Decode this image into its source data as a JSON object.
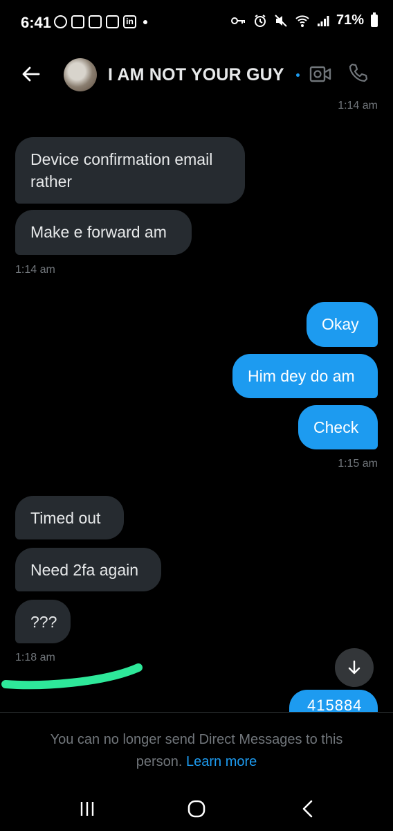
{
  "status_bar": {
    "time": "6:41",
    "battery": "71%",
    "notification_icons": [
      "facebook-icon",
      "app-icon",
      "app-icon",
      "app-icon",
      "linkedin-icon"
    ],
    "status_icons": [
      "vpn-key-icon",
      "alarm-icon",
      "mute-icon",
      "wifi-icon",
      "signal-icon",
      "battery-icon"
    ]
  },
  "header": {
    "title": "I AM NOT YOUR GUY",
    "accent": "#1d9bf0"
  },
  "messages": {
    "ts1": "1:14 am",
    "m1": "Device confirmation email rather",
    "m2": "Make e forward am",
    "ts2": "1:14 am",
    "m3": "Okay",
    "m4": "Him dey do am",
    "m5": "Check",
    "ts3": "1:15 am",
    "m6": "Timed out",
    "m7": "Need 2fa again",
    "m8": "???",
    "ts4": "1:18 am",
    "partial": "415884"
  },
  "footer": {
    "notice": "You can no longer send Direct Messages to this person.",
    "link": "Learn more"
  },
  "colors": {
    "background": "#000000",
    "incoming_bubble": "#262b30",
    "outgoing_bubble": "#1d9bf0",
    "highlight": "#2ee89a",
    "muted_text": "#71767b"
  }
}
